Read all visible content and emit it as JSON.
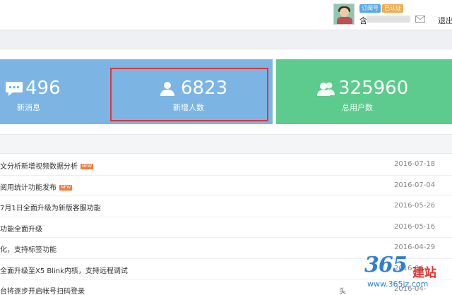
{
  "header": {
    "badge_subscription": "订阅号",
    "badge_verified": "已认证",
    "account_name": "含",
    "logout_label": "退出"
  },
  "stats": {
    "messages": {
      "value": "496",
      "label": "新消息",
      "icon": "chat-icon"
    },
    "new_followers": {
      "value": "6823",
      "label": "新增人数",
      "icon": "user-icon"
    },
    "total_users": {
      "value": "325960",
      "label": "总用户数",
      "icon": "users-icon"
    }
  },
  "news": {
    "new_tag": "NEW",
    "items": [
      {
        "title": "文分析新增视频数据分析",
        "date": "2016-07-18",
        "is_new": true
      },
      {
        "title": "阅用统计功能发布",
        "date": "2016-07-04",
        "is_new": true
      },
      {
        "title": "7月1日全面升级为新版客服功能",
        "date": "2016-05-26",
        "is_new": false
      },
      {
        "title": "功能全面升级",
        "date": "2016-05-16",
        "is_new": false
      },
      {
        "title": "化，支持标签功能",
        "date": "2016-04-29",
        "is_new": false
      },
      {
        "title": "全面升级至X5 Blink内核，支持远程调试",
        "date": "2016-04-",
        "is_new": false
      },
      {
        "title": "台将逐步开启帐号扫码登录",
        "date": "2016-04-",
        "is_new": false
      }
    ]
  },
  "watermark": {
    "number": "365",
    "name": "建站",
    "url": "www.365jz.com",
    "head": "头"
  },
  "colors": {
    "card_blue": "#7cb5e4",
    "card_green": "#5ccb8d",
    "highlight_red": "#d9373c",
    "new_tag": "#f07a3a"
  }
}
